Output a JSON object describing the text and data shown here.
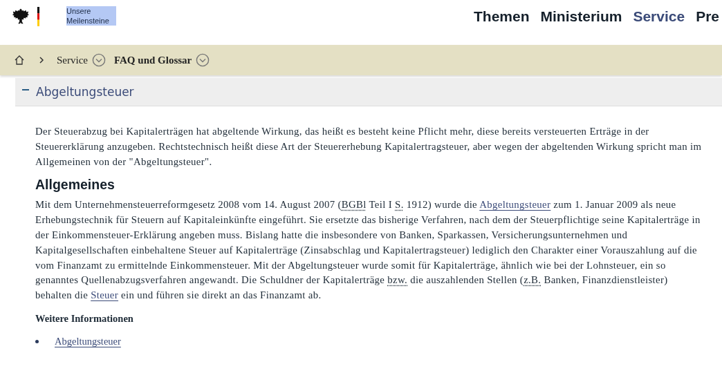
{
  "header": {
    "tagline": {
      "text": "Unsere Meilensteine",
      "highlighted": true
    },
    "nav": [
      {
        "label": "Themen",
        "selected": false
      },
      {
        "label": "Ministerium",
        "selected": false
      },
      {
        "label": "Service",
        "selected": true
      },
      {
        "label": "Pre",
        "selected": false
      }
    ]
  },
  "breadcrumb": [
    {
      "label": "Service",
      "current": false
    },
    {
      "label": "FAQ und Glossar",
      "current": true
    }
  ],
  "accordion": {
    "title": "Abgeltungsteuer",
    "expanded": true,
    "intro": "Der Steuerabzug bei Kapitalerträgen hat abgeltende Wirkung, das heißt es besteht keine Pflicht mehr, diese bereits versteuerten Erträge in der Steuererklärung anzugeben. Rechtstechnisch heißt diese Art der Steuererhebung Kapitalertragsteuer, aber wegen der abgeltenden Wirkung spricht man im Allgemeinen von der \"Abgeltungsteuer\".",
    "heading": "Allgemeines",
    "body": [
      {
        "kind": "text",
        "text": "Mit dem Unternehmensteuerreformgesetz 2008 vom 14. August 2007 ("
      },
      {
        "kind": "abbr",
        "text": "BGBl"
      },
      {
        "kind": "text",
        "text": " Teil I "
      },
      {
        "kind": "abbr",
        "text": "S."
      },
      {
        "kind": "text",
        "text": " 1912) wurde die "
      },
      {
        "kind": "link",
        "text": "Abgeltungsteuer"
      },
      {
        "kind": "text",
        "text": " zum 1. Januar 2009 als neue Erhebungstechnik für Steuern auf Kapitaleinkünfte eingeführt. Sie ersetzte das bisherige Verfahren, nach dem der Steuerpflichtige seine Kapitalerträge in der Einkommensteuer-Erklärung angeben muss. Bislang hatte die insbesondere von Banken, Sparkassen, Versicherungsunternehmen und Kapitalgesellschaften einbehaltene Steuer auf Kapitalerträge (Zinsabschlag und Kapitalertragsteuer) lediglich den Charakter einer Vorauszahlung auf die vom Finanzamt zu ermittelnde Einkommensteuer. Mit der Abgeltungsteuer wurde somit für Kapitalerträge, ähnlich wie bei der Lohnsteuer, ein so genanntes Quellenabzugsverfahren angewandt. Die Schuldner der Kapitalerträge "
      },
      {
        "kind": "abbr",
        "text": "bzw."
      },
      {
        "kind": "text",
        "text": " die auszahlenden Stellen ("
      },
      {
        "kind": "abbr",
        "text": "z.B."
      },
      {
        "kind": "text",
        "text": " Banken, Finanzdienstleister) behalten die "
      },
      {
        "kind": "link",
        "text": "Steuer"
      },
      {
        "kind": "text",
        "text": " ein und führen sie direkt an das Finanzamt ab."
      }
    ],
    "more_heading": "Weitere Informationen",
    "links": [
      "Abgeltungsteuer"
    ]
  }
}
